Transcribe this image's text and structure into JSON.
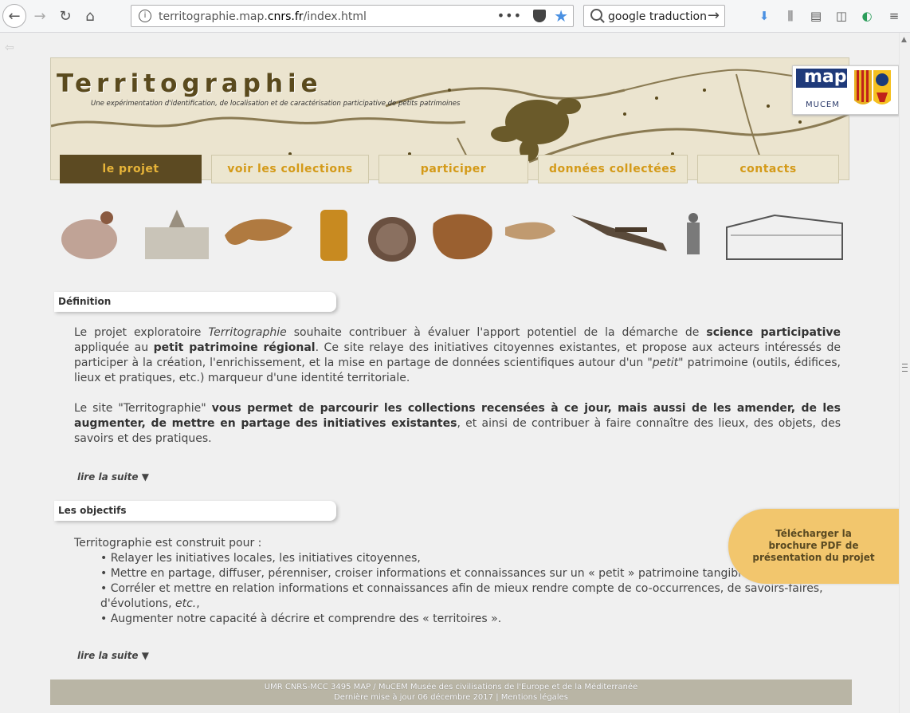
{
  "browser": {
    "url_prefix": "territographie.map.",
    "url_domain": "cnrs.fr",
    "url_suffix": "/index.html",
    "search_text": "google traduction",
    "menu_dots": "•••"
  },
  "header": {
    "title": "Territographie",
    "subtitle": "Une expérimentation d'identification, de localisation et de caractérisation participative de petits patrimoines",
    "logo_map": "map",
    "logo_mucem": "MUCEM"
  },
  "tabs": [
    {
      "label": "le projet",
      "active": true
    },
    {
      "label": "voir les collections"
    },
    {
      "label": "participer"
    },
    {
      "label": "données collectées"
    },
    {
      "label": "contacts"
    }
  ],
  "definition": {
    "heading": "Définition",
    "p1_a": "Le projet exploratoire ",
    "p1_b": "Territographie",
    "p1_c": " souhaite contribuer à évaluer l'apport potentiel de la démarche de ",
    "p1_d": "science participative",
    "p1_e": " appliquée au ",
    "p1_f": "petit patrimoine régional",
    "p1_g": ". Ce site relaye des initiatives citoyennes existantes, et propose aux acteurs intéressés de participer à la création, l'enrichissement, et la mise en partage de données scientifiques autour d'un ",
    "p1_h": "\"petit\"",
    "p1_i": " patrimoine (outils, édifices, lieux et pratiques, etc.) marqueur d'une identité territoriale.",
    "p2_a": "Le site \"Territographie\" ",
    "p2_b": "vous permet de parcourir les collections recensées à ce jour, mais aussi de les amender, de les augmenter, de mettre en partage des initiatives existantes",
    "p2_c": ", et ainsi de contribuer à faire connaître des lieux, des objets, des savoirs et des pratiques.",
    "read_more": "lire la suite ▼"
  },
  "objectives": {
    "heading": "Les objectifs",
    "intro": "Territographie est construit pour :",
    "items": [
      "• Relayer les initiatives locales, les initiatives citoyennes,",
      "• Mettre en partage, diffuser, pérenniser, croiser informations et connaissances sur un « petit » patrimoine tangible et intangible,",
      "• Corréler et mettre en relation informations et connaissances afin de mieux rendre compte de co-occurrences, de savoirs-faires, d'évolutions, ",
      "• Augmenter notre capacité à décrire et comprendre des « territoires »."
    ],
    "item3_etc": "etc.",
    "item3_end": ",",
    "read_more": "lire la suite ▼"
  },
  "brochure": {
    "label": "Télécharger la brochure PDF de présentation du projet"
  },
  "footer": {
    "line1": "UMR CNRS-MCC 3495 MAP / MuCEM Musée des civilisations de l'Europe et de la Méditerranée",
    "line2": "Dernière mise à jour 06 décembre 2017 | Mentions légales"
  },
  "colors": {
    "tab_active_bg": "#5c4a22",
    "tab_text": "#d49a18",
    "brochure_bg": "#f2c66d",
    "footer_bg": "#b9b5a5"
  }
}
